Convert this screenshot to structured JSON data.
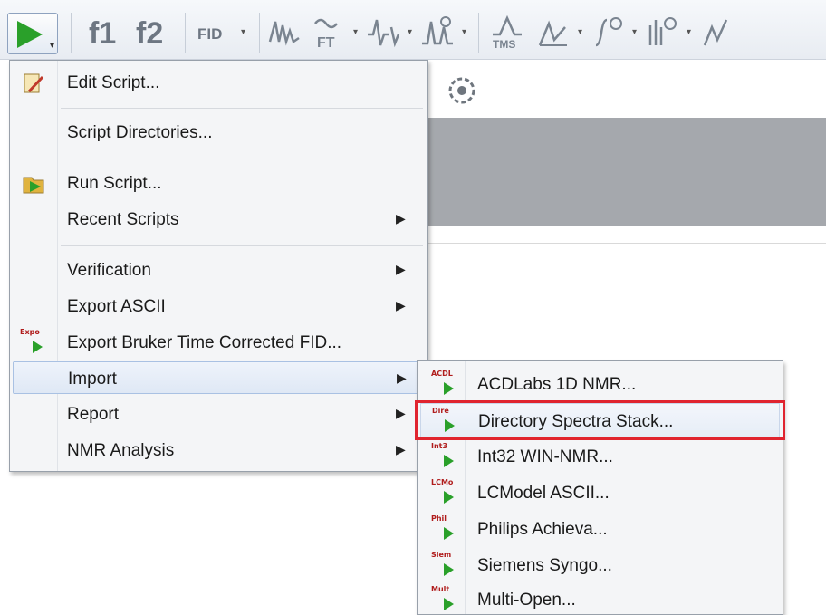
{
  "toolbar": {
    "run_icon": "run-play-icon",
    "f1": "f1",
    "f2": "f2",
    "fid": "FID",
    "ft": "FT",
    "tms": "TMS"
  },
  "menu": {
    "items": [
      {
        "label": "Edit Script...",
        "icon": "edit-script-icon",
        "has_submenu": false
      },
      {
        "label": "Script Directories...",
        "icon": "",
        "has_submenu": false
      },
      {
        "label": "Run Script...",
        "icon": "run-script-icon",
        "has_submenu": false
      },
      {
        "label": "Recent Scripts",
        "icon": "",
        "has_submenu": true
      },
      {
        "label": "Verification",
        "icon": "",
        "has_submenu": true
      },
      {
        "label": "Export ASCII",
        "icon": "",
        "has_submenu": true
      },
      {
        "label": "Export Bruker Time Corrected FID...",
        "icon": "export-bruker-icon",
        "icon_tag": "Expo",
        "has_submenu": false
      },
      {
        "label": "Import",
        "icon": "",
        "has_submenu": true,
        "active": true
      },
      {
        "label": "Report",
        "icon": "",
        "has_submenu": true
      },
      {
        "label": "NMR Analysis",
        "icon": "",
        "has_submenu": true
      }
    ],
    "arrow": "▶"
  },
  "submenu": {
    "items": [
      {
        "label": "ACDLabs 1D NMR...",
        "tag": "ACDL"
      },
      {
        "label": "Directory Spectra Stack...",
        "tag": "Dire",
        "highlighted": true
      },
      {
        "label": "Int32 WIN-NMR...",
        "tag": "Int3"
      },
      {
        "label": "LCModel ASCII...",
        "tag": "LCMo"
      },
      {
        "label": "Philips Achieva...",
        "tag": "Phil"
      },
      {
        "label": "Siemens Syngo...",
        "tag": "Siem"
      },
      {
        "label": "Multi-Open...",
        "tag": "Mult"
      }
    ]
  },
  "colors": {
    "play_green": "#2aa02a",
    "highlight_red": "#e0242f",
    "menu_bg": "#f4f5f7"
  }
}
